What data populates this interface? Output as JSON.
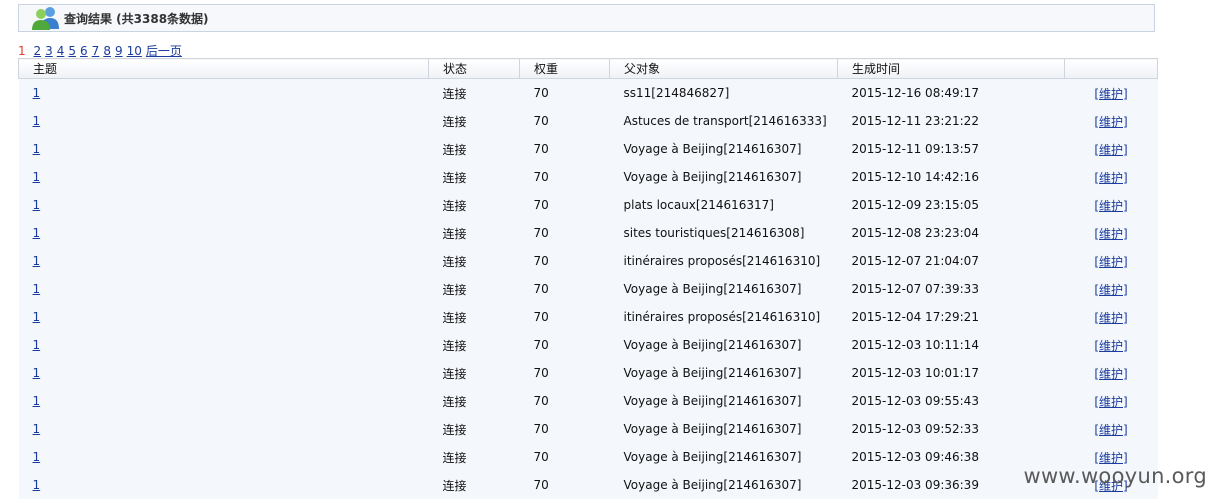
{
  "header": {
    "title": "查询结果 (共3388条数据)"
  },
  "pager": {
    "current": "1",
    "pages": [
      "2",
      "3",
      "4",
      "5",
      "6",
      "7",
      "8",
      "9",
      "10"
    ],
    "next_label": "后一页"
  },
  "table": {
    "columns": [
      "主题",
      "状态",
      "权重",
      "父对象",
      "生成时间",
      ""
    ],
    "rows": [
      {
        "subject": "1",
        "status": "连接",
        "weight": "70",
        "parent": "ss11[214846827]",
        "time": "2015-12-16 08:49:17",
        "action": "[维护]"
      },
      {
        "subject": "1",
        "status": "连接",
        "weight": "70",
        "parent": "Astuces de transport[214616333]",
        "time": "2015-12-11 23:21:22",
        "action": "[维护]"
      },
      {
        "subject": "1",
        "status": "连接",
        "weight": "70",
        "parent": "Voyage à Beijing[214616307]",
        "time": "2015-12-11 09:13:57",
        "action": "[维护]"
      },
      {
        "subject": "1",
        "status": "连接",
        "weight": "70",
        "parent": "Voyage à Beijing[214616307]",
        "time": "2015-12-10 14:42:16",
        "action": "[维护]"
      },
      {
        "subject": "1",
        "status": "连接",
        "weight": "70",
        "parent": "plats locaux[214616317]",
        "time": "2015-12-09 23:15:05",
        "action": "[维护]"
      },
      {
        "subject": "1",
        "status": "连接",
        "weight": "70",
        "parent": "sites touristiques[214616308]",
        "time": "2015-12-08 23:23:04",
        "action": "[维护]"
      },
      {
        "subject": "1",
        "status": "连接",
        "weight": "70",
        "parent": "itinéraires proposés[214616310]",
        "time": "2015-12-07 21:04:07",
        "action": "[维护]"
      },
      {
        "subject": "1",
        "status": "连接",
        "weight": "70",
        "parent": "Voyage à Beijing[214616307]",
        "time": "2015-12-07 07:39:33",
        "action": "[维护]"
      },
      {
        "subject": "1",
        "status": "连接",
        "weight": "70",
        "parent": "itinéraires proposés[214616310]",
        "time": "2015-12-04 17:29:21",
        "action": "[维护]"
      },
      {
        "subject": "1",
        "status": "连接",
        "weight": "70",
        "parent": "Voyage à Beijing[214616307]",
        "time": "2015-12-03 10:11:14",
        "action": "[维护]"
      },
      {
        "subject": "1",
        "status": "连接",
        "weight": "70",
        "parent": "Voyage à Beijing[214616307]",
        "time": "2015-12-03 10:01:17",
        "action": "[维护]"
      },
      {
        "subject": "1",
        "status": "连接",
        "weight": "70",
        "parent": "Voyage à Beijing[214616307]",
        "time": "2015-12-03 09:55:43",
        "action": "[维护]"
      },
      {
        "subject": "1",
        "status": "连接",
        "weight": "70",
        "parent": "Voyage à Beijing[214616307]",
        "time": "2015-12-03 09:52:33",
        "action": "[维护]"
      },
      {
        "subject": "1",
        "status": "连接",
        "weight": "70",
        "parent": "Voyage à Beijing[214616307]",
        "time": "2015-12-03 09:46:38",
        "action": "[维护]"
      },
      {
        "subject": "1",
        "status": "连接",
        "weight": "70",
        "parent": "Voyage à Beijing[214616307]",
        "time": "2015-12-03 09:36:39",
        "action": "[维护]"
      }
    ]
  },
  "watermark": "www.wooyun.org",
  "colors": {
    "link": "#1a3c9e",
    "current_page": "#e23b2e",
    "row_bg": "#f4f7fc",
    "header_border": "#c9d3e4"
  },
  "icons": {
    "header": "users-icon"
  }
}
